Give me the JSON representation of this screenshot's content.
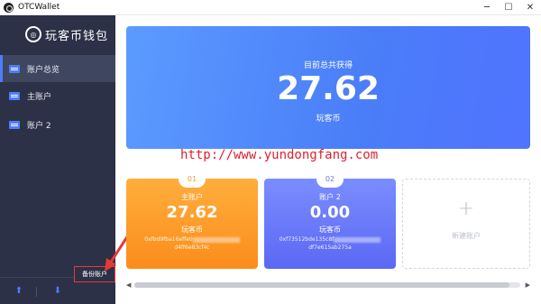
{
  "window": {
    "title": "OTCWallet",
    "minimize": "─",
    "maximize": "☐",
    "close": "✕"
  },
  "logo": {
    "text": "玩客币钱包",
    "mark": "◎"
  },
  "sidebar": {
    "items": [
      {
        "label": "账户总览",
        "active": true
      },
      {
        "label": "主账户",
        "active": false
      },
      {
        "label": "账户 2",
        "active": false
      }
    ],
    "backup_label": "备份账户"
  },
  "summary": {
    "label": "目前总共获得",
    "value": "27.62",
    "unit": "玩客币"
  },
  "watermark": "http://www.yundongfang.com",
  "accounts": [
    {
      "badge": "01",
      "name": "主账户",
      "value": "27.62",
      "unit": "玩客币",
      "addr_start": "0xfbd9fba16effe0",
      "addr_end": "d4ff6e83cf4c"
    },
    {
      "badge": "02",
      "name": "账户 2",
      "value": "0.00",
      "unit": "玩客币",
      "addr_start": "0xf73512bde135c8f",
      "addr_end": "df7e615ab275a"
    }
  ],
  "new_account": {
    "plus": "+",
    "label": "新建账户"
  },
  "scroll": {
    "left": "◀",
    "right": "▶",
    "position": 0.97
  },
  "colors": {
    "sidebar": "#2c3147",
    "accent": "#4d7cff",
    "orange": "#fb8c1b",
    "purple": "#5b68f4",
    "annotation": "#e53935"
  }
}
